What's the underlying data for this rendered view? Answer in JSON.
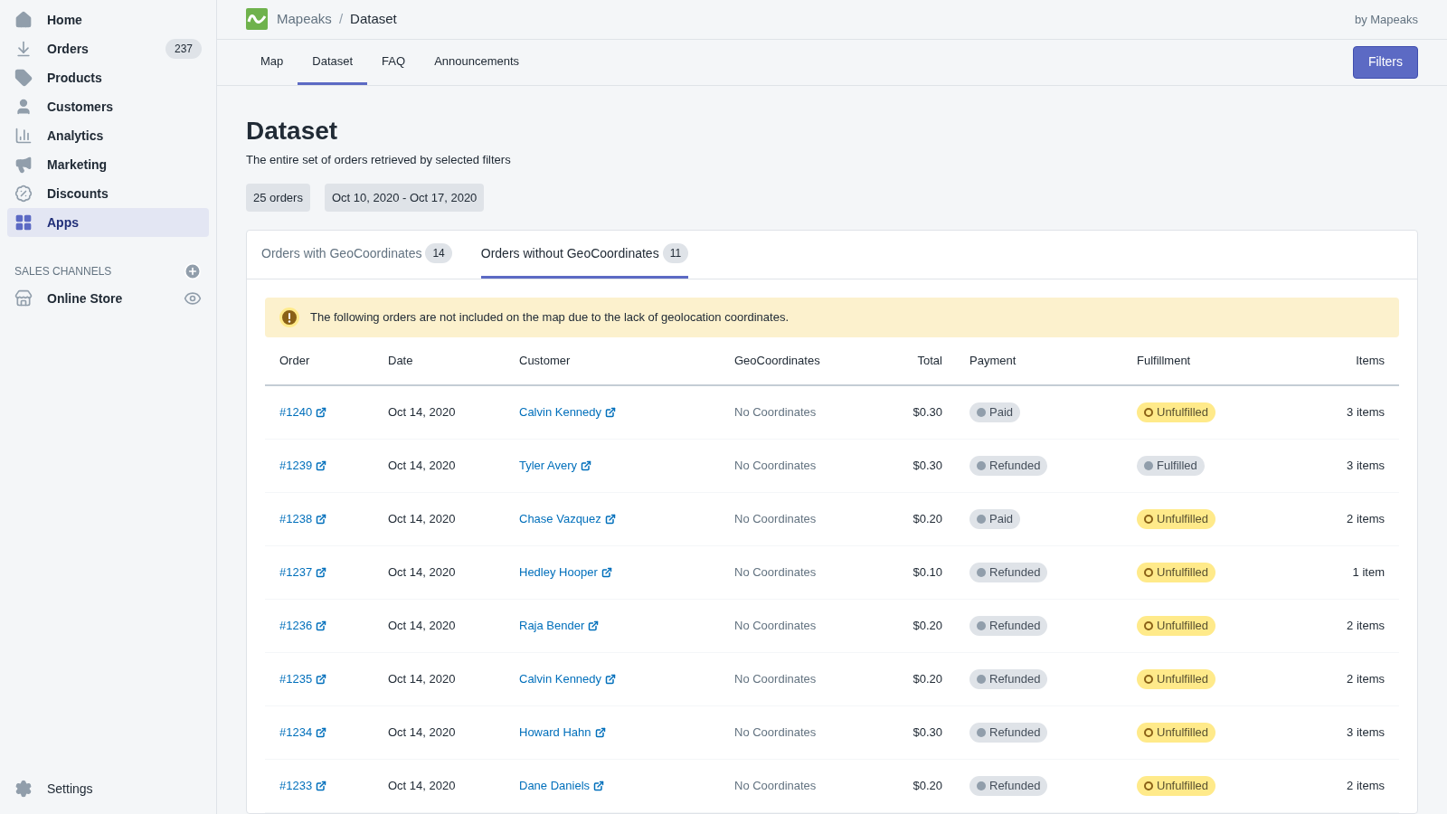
{
  "sidebar": {
    "items": [
      {
        "label": "Home",
        "selected": false
      },
      {
        "label": "Orders",
        "badge": "237",
        "selected": false
      },
      {
        "label": "Products",
        "selected": false
      },
      {
        "label": "Customers",
        "selected": false
      },
      {
        "label": "Analytics",
        "selected": false
      },
      {
        "label": "Marketing",
        "selected": false
      },
      {
        "label": "Discounts",
        "selected": false
      },
      {
        "label": "Apps",
        "selected": true
      }
    ],
    "sales_channels": {
      "heading": "SALES CHANNELS",
      "items": [
        {
          "label": "Online Store"
        }
      ]
    },
    "settings": "Settings"
  },
  "header": {
    "breadcrumb": [
      "Mapeaks",
      "Dataset"
    ],
    "separator": "/",
    "by": "by Mapeaks"
  },
  "nav_tabs": [
    {
      "label": "Map",
      "selected": false
    },
    {
      "label": "Dataset",
      "selected": true
    },
    {
      "label": "FAQ",
      "selected": false
    },
    {
      "label": "Announcements",
      "selected": false
    }
  ],
  "filters_button": "Filters",
  "page": {
    "title": "Dataset",
    "subtitle": "The entire set of orders retrieved by selected filters",
    "tags": [
      "25 orders",
      "Oct 10, 2020 - Oct 17, 2020"
    ]
  },
  "card_tabs": [
    {
      "label": "Orders with GeoCoordinates",
      "count": "14",
      "selected": false
    },
    {
      "label": "Orders without GeoCoordinates",
      "count": "11",
      "selected": true
    }
  ],
  "banner": "The following orders are not included on the map due to the lack of geolocation coordinates.",
  "table": {
    "columns": [
      "Order",
      "Date",
      "Customer",
      "GeoCoordinates",
      "Total",
      "Payment",
      "Fulfillment",
      "Items"
    ],
    "rows": [
      {
        "order": "#1240",
        "date": "Oct 14, 2020",
        "customer": "Calvin Kennedy",
        "geo": "No Coordinates",
        "total": "$0.30",
        "payment": {
          "label": "Paid",
          "kind": "neutral"
        },
        "fulfillment": {
          "label": "Unfulfilled",
          "kind": "attention"
        },
        "items": "3 items"
      },
      {
        "order": "#1239",
        "date": "Oct 14, 2020",
        "customer": "Tyler Avery",
        "geo": "No Coordinates",
        "total": "$0.30",
        "payment": {
          "label": "Refunded",
          "kind": "neutral"
        },
        "fulfillment": {
          "label": "Fulfilled",
          "kind": "neutral"
        },
        "items": "3 items"
      },
      {
        "order": "#1238",
        "date": "Oct 14, 2020",
        "customer": "Chase Vazquez",
        "geo": "No Coordinates",
        "total": "$0.20",
        "payment": {
          "label": "Paid",
          "kind": "neutral"
        },
        "fulfillment": {
          "label": "Unfulfilled",
          "kind": "attention"
        },
        "items": "2 items"
      },
      {
        "order": "#1237",
        "date": "Oct 14, 2020",
        "customer": "Hedley Hooper",
        "geo": "No Coordinates",
        "total": "$0.10",
        "payment": {
          "label": "Refunded",
          "kind": "neutral"
        },
        "fulfillment": {
          "label": "Unfulfilled",
          "kind": "attention"
        },
        "items": "1 item"
      },
      {
        "order": "#1236",
        "date": "Oct 14, 2020",
        "customer": "Raja Bender",
        "geo": "No Coordinates",
        "total": "$0.20",
        "payment": {
          "label": "Refunded",
          "kind": "neutral"
        },
        "fulfillment": {
          "label": "Unfulfilled",
          "kind": "attention"
        },
        "items": "2 items"
      },
      {
        "order": "#1235",
        "date": "Oct 14, 2020",
        "customer": "Calvin Kennedy",
        "geo": "No Coordinates",
        "total": "$0.20",
        "payment": {
          "label": "Refunded",
          "kind": "neutral"
        },
        "fulfillment": {
          "label": "Unfulfilled",
          "kind": "attention"
        },
        "items": "2 items"
      },
      {
        "order": "#1234",
        "date": "Oct 14, 2020",
        "customer": "Howard Hahn",
        "geo": "No Coordinates",
        "total": "$0.30",
        "payment": {
          "label": "Refunded",
          "kind": "neutral"
        },
        "fulfillment": {
          "label": "Unfulfilled",
          "kind": "attention"
        },
        "items": "3 items"
      },
      {
        "order": "#1233",
        "date": "Oct 14, 2020",
        "customer": "Dane Daniels",
        "geo": "No Coordinates",
        "total": "$0.20",
        "payment": {
          "label": "Refunded",
          "kind": "neutral"
        },
        "fulfillment": {
          "label": "Unfulfilled",
          "kind": "attention"
        },
        "items": "2 items"
      }
    ]
  }
}
